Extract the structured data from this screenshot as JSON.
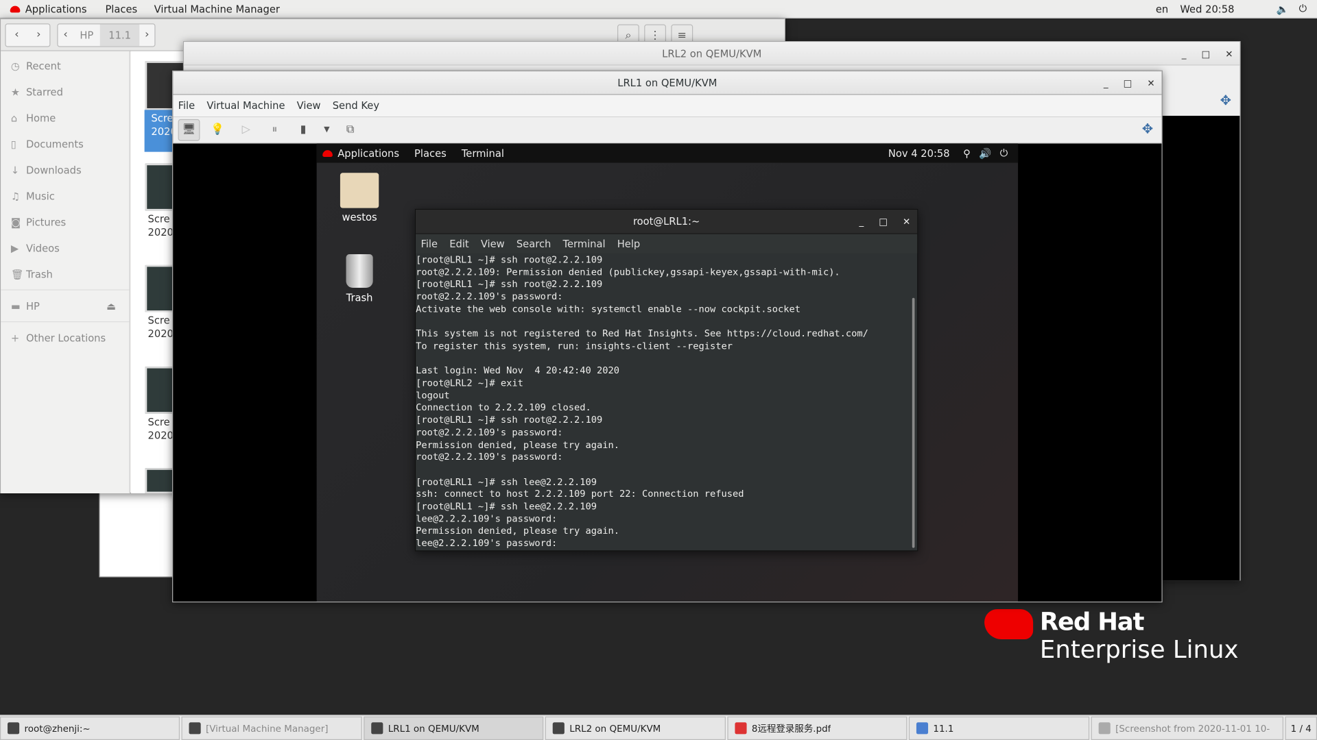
{
  "topbar": {
    "applications": "Applications",
    "places": "Places",
    "app_menu": "Virtual Machine Manager",
    "lang": "en",
    "clock": "Wed 20:58"
  },
  "files": {
    "path": [
      "HP",
      "11.1"
    ],
    "sidebar": [
      {
        "icon": "clock-icon",
        "label": "Recent"
      },
      {
        "icon": "star-icon",
        "label": "Starred"
      },
      {
        "icon": "home-icon",
        "label": "Home"
      },
      {
        "icon": "document-icon",
        "label": "Documents"
      },
      {
        "icon": "download-icon",
        "label": "Downloads"
      },
      {
        "icon": "music-icon",
        "label": "Music"
      },
      {
        "icon": "camera-icon",
        "label": "Pictures"
      },
      {
        "icon": "video-icon",
        "label": "Videos"
      },
      {
        "icon": "trash-icon",
        "label": "Trash"
      }
    ],
    "drive": "HP",
    "other": "Other Locations",
    "thumbs": [
      {
        "l1": "Scre",
        "l2": "2020-"
      },
      {
        "l1": "Scre",
        "l2": "2020-"
      },
      {
        "l1": "Scre",
        "l2": "2020-"
      },
      {
        "l1": "Scre",
        "l2": "2020-"
      }
    ]
  },
  "lrl2": {
    "title": "LRL2 on QEMU/KVM"
  },
  "lrl1": {
    "title": "LRL1 on QEMU/KVM",
    "menu": [
      "File",
      "Virtual Machine",
      "View",
      "Send Key"
    ]
  },
  "guest": {
    "applications": "Applications",
    "places": "Places",
    "app_menu": "Terminal",
    "clock": "Nov 4  20:58",
    "desktop_icons": [
      "westos",
      "Trash"
    ]
  },
  "terminal": {
    "title": "root@LRL1:~",
    "menu": [
      "File",
      "Edit",
      "View",
      "Search",
      "Terminal",
      "Help"
    ],
    "lines": [
      "[root@LRL1 ~]# ssh root@2.2.2.109",
      "root@2.2.2.109: Permission denied (publickey,gssapi-keyex,gssapi-with-mic).",
      "[root@LRL1 ~]# ssh root@2.2.2.109",
      "root@2.2.2.109's password:",
      "Activate the web console with: systemctl enable --now cockpit.socket",
      "",
      "This system is not registered to Red Hat Insights. See https://cloud.redhat.com/",
      "To register this system, run: insights-client --register",
      "",
      "Last login: Wed Nov  4 20:42:40 2020",
      "[root@LRL2 ~]# exit",
      "logout",
      "Connection to 2.2.2.109 closed.",
      "[root@LRL1 ~]# ssh root@2.2.2.109",
      "root@2.2.2.109's password:",
      "Permission denied, please try again.",
      "root@2.2.2.109's password:",
      "",
      "[root@LRL1 ~]# ssh lee@2.2.2.109",
      "ssh: connect to host 2.2.2.109 port 22: Connection refused",
      "[root@LRL1 ~]# ssh lee@2.2.2.109",
      "lee@2.2.2.109's password:",
      "Permission denied, please try again.",
      "lee@2.2.2.109's password:"
    ]
  },
  "branding": {
    "line1": "Red Hat",
    "line2": "Enterprise Linux"
  },
  "taskbar": [
    "root@zhenji:~",
    "[Virtual Machine Manager]",
    "LRL1 on QEMU/KVM",
    "LRL2 on QEMU/KVM",
    "8远程登录服务.pdf",
    "11.1",
    "[Screenshot from 2020-11-01 10-"
  ],
  "workspace": "1 / 4"
}
